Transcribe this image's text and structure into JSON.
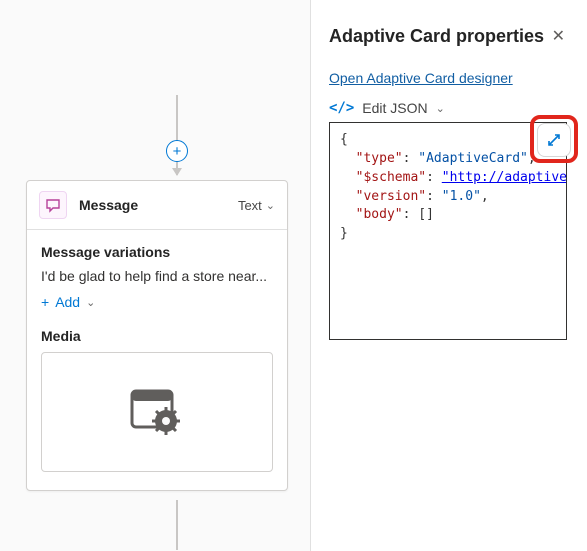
{
  "panel": {
    "title": "Adaptive Card properties",
    "close_label": "✕",
    "designer_link": "Open Adaptive Card designer",
    "edit_json_label": "Edit JSON",
    "json": {
      "line1_open": "{",
      "key_type": "\"type\"",
      "val_type": "\"AdaptiveCard\"",
      "key_schema": "\"$schema\"",
      "val_schema": "\"http://adaptivecards.i",
      "key_version": "\"version\"",
      "val_version": "\"1.0\"",
      "key_body": "\"body\"",
      "val_body": "[]",
      "line_close": "}"
    }
  },
  "node": {
    "title": "Message",
    "type_label": "Text",
    "variations_label": "Message variations",
    "variation_text": "I'd be glad to help find a store near...",
    "add_label": "Add",
    "media_label": "Media"
  },
  "icons": {
    "plus": "+",
    "chev_down": "⌄",
    "colon": ": "
  }
}
